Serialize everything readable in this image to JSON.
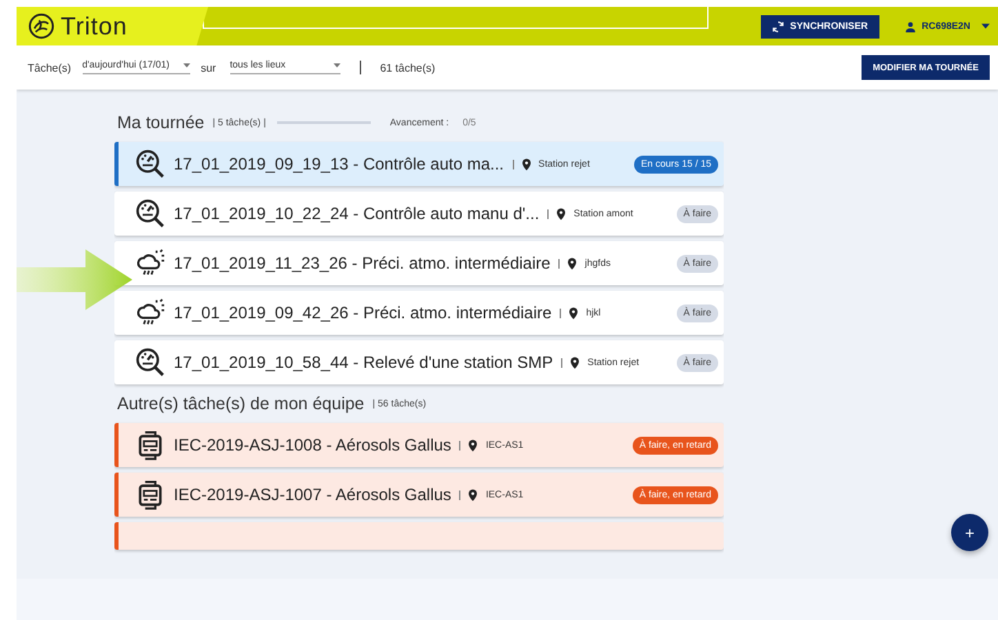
{
  "header": {
    "logo": "Triton",
    "sync_button": "SYNCHRONISER",
    "user": "RC698E2N"
  },
  "filters": {
    "label": "Tâche(s)",
    "period": "d'aujourd'hui (17/01)",
    "separator": "sur",
    "place": "tous les lieux",
    "count": "61 tâche(s)",
    "button": "MODIFIER MA TOURNÉE"
  },
  "tour": {
    "title": "Ma tournée",
    "count": "| 5 tâche(s) |",
    "progress_label": "Avancement :",
    "progress_value": "0/5",
    "level": 0,
    "tasks": [
      {
        "kind": "gauge",
        "title": "17_01_2019_09_19_13 - Contrôle auto ma...",
        "place": "Station rejet",
        "status": {
          "text": "En cours 15 / 15",
          "kind": "in_progress"
        },
        "selected": true
      },
      {
        "kind": "gauge",
        "title": "17_01_2019_10_22_24 - Contrôle auto manu d'...",
        "place": "Station amont",
        "status": {
          "text": "À faire",
          "kind": "todo"
        },
        "selected": false
      },
      {
        "kind": "weather",
        "title": "17_01_2019_11_23_26 - Préci. atmo. intermédiaire",
        "place": "jhgfds",
        "status": {
          "text": "À faire",
          "kind": "todo"
        },
        "selected": false
      },
      {
        "kind": "weather",
        "title": "17_01_2019_09_42_26 - Préci. atmo. intermédiaire",
        "place": "hjkl",
        "status": {
          "text": "À faire",
          "kind": "todo"
        },
        "selected": false
      },
      {
        "kind": "gauge",
        "title": "17_01_2019_10_58_44 - Relevé d'une station SMP",
        "place": "Station rejet",
        "status": {
          "text": "À faire",
          "kind": "todo"
        },
        "selected": false
      }
    ]
  },
  "team": {
    "title": "Autre(s) tâche(s) de mon équipe",
    "count": "| 56 tâche(s)",
    "tasks": [
      {
        "kind": "device",
        "title": "IEC-2019-ASJ-1008 - Aérosols Gallus",
        "place": "IEC-AS1",
        "status": {
          "text": "À faire, en retard",
          "kind": "late"
        },
        "selected": false
      },
      {
        "kind": "device",
        "title": "IEC-2019-ASJ-1007 - Aérosols Gallus",
        "place": "IEC-AS1",
        "status": {
          "text": "À faire, en retard",
          "kind": "late"
        },
        "selected": false
      }
    ]
  },
  "fab": "+"
}
